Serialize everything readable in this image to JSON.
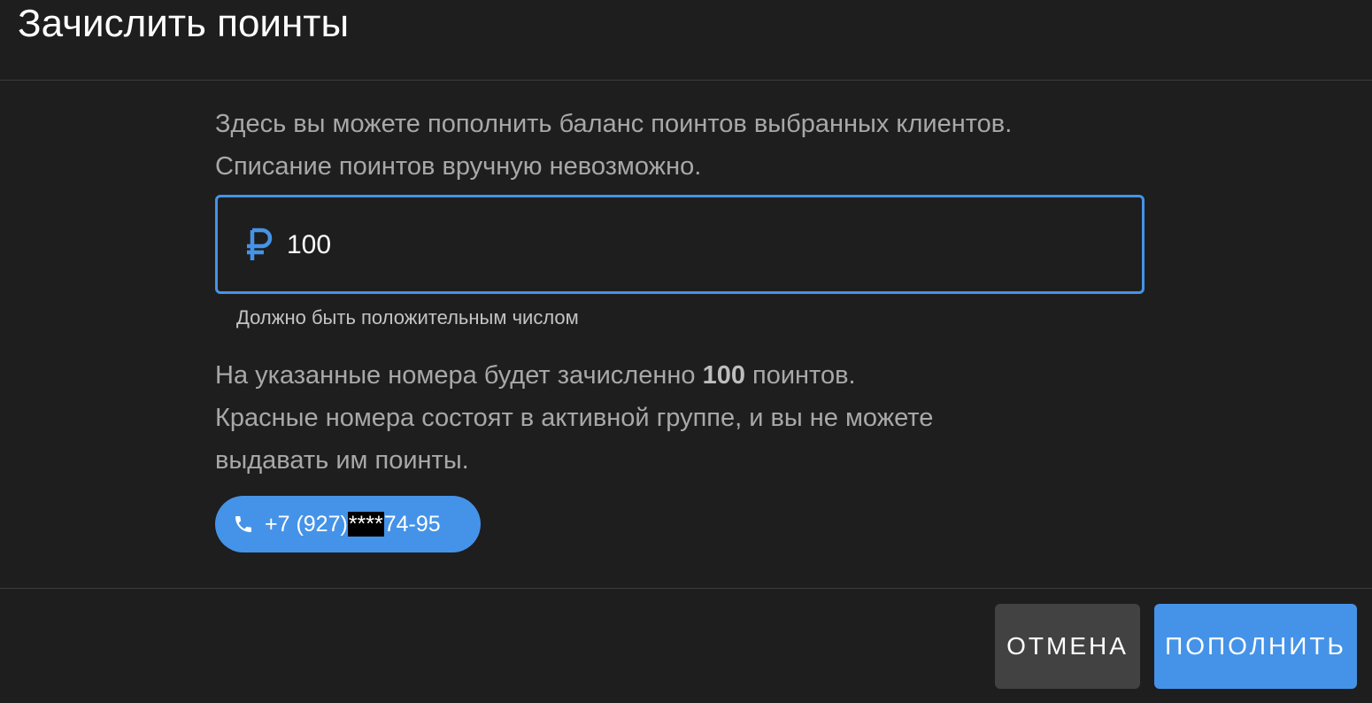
{
  "dialog": {
    "title": "Зачислить поинты",
    "intro_line1": "Здесь вы можете пополнить баланс поинтов выбранных клиентов.",
    "intro_line2": "Списание поинтов вручную невозможно.",
    "amount_field": {
      "icon": "ruble-icon",
      "value": "100",
      "hint": "Должно быть положительным числом"
    },
    "info": {
      "line1_before": "На указанные номера будет зачисленно ",
      "line1_amount": "100",
      "line1_after": " поинтов.",
      "line2": "Красные номера состоят в активной группе, и вы не можете",
      "line3": "выдавать им поинты."
    },
    "phones": [
      {
        "icon": "phone-icon",
        "prefix": "+7 (927)",
        "masked": "****",
        "suffix": "74-95"
      }
    ],
    "buttons": {
      "cancel": "ОТМЕНА",
      "submit": "ПОПОЛНИТЬ"
    },
    "colors": {
      "accent": "#4593e8",
      "background": "#1e1e1e",
      "cancel_bg": "#424242"
    }
  }
}
